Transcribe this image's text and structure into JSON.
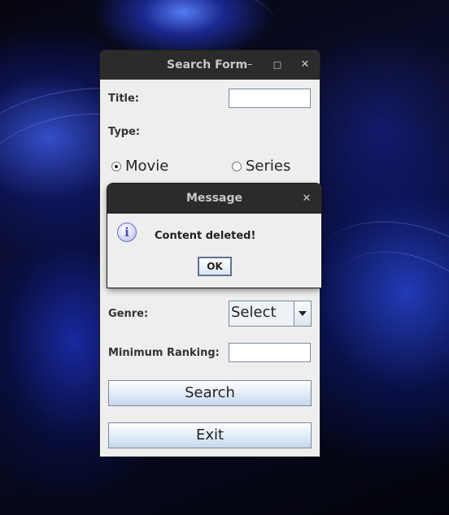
{
  "search_form": {
    "title": "Search Form",
    "minimize_glyph": "–",
    "maximize_glyph": "□",
    "close_glyph": "✕",
    "title_label": "Title:",
    "title_value": "",
    "type_label": "Type:",
    "type_options": [
      {
        "label": "Movie",
        "selected": true
      },
      {
        "label": "Series",
        "selected": false
      }
    ],
    "genre_label": "Genre:",
    "genre_selected": "Select",
    "min_ranking_label": "Minimum Ranking:",
    "min_ranking_value": "",
    "search_button": "Search",
    "exit_button": "Exit"
  },
  "message_dialog": {
    "title": "Message",
    "close_glyph": "✕",
    "icon": "info-icon",
    "icon_glyph": "i",
    "text": "Content deleted!",
    "ok_button": "OK"
  },
  "colors": {
    "titlebar": "#2b2b2b",
    "window_bg": "#eeeeee",
    "desktop_accent": "#2f4de0"
  }
}
